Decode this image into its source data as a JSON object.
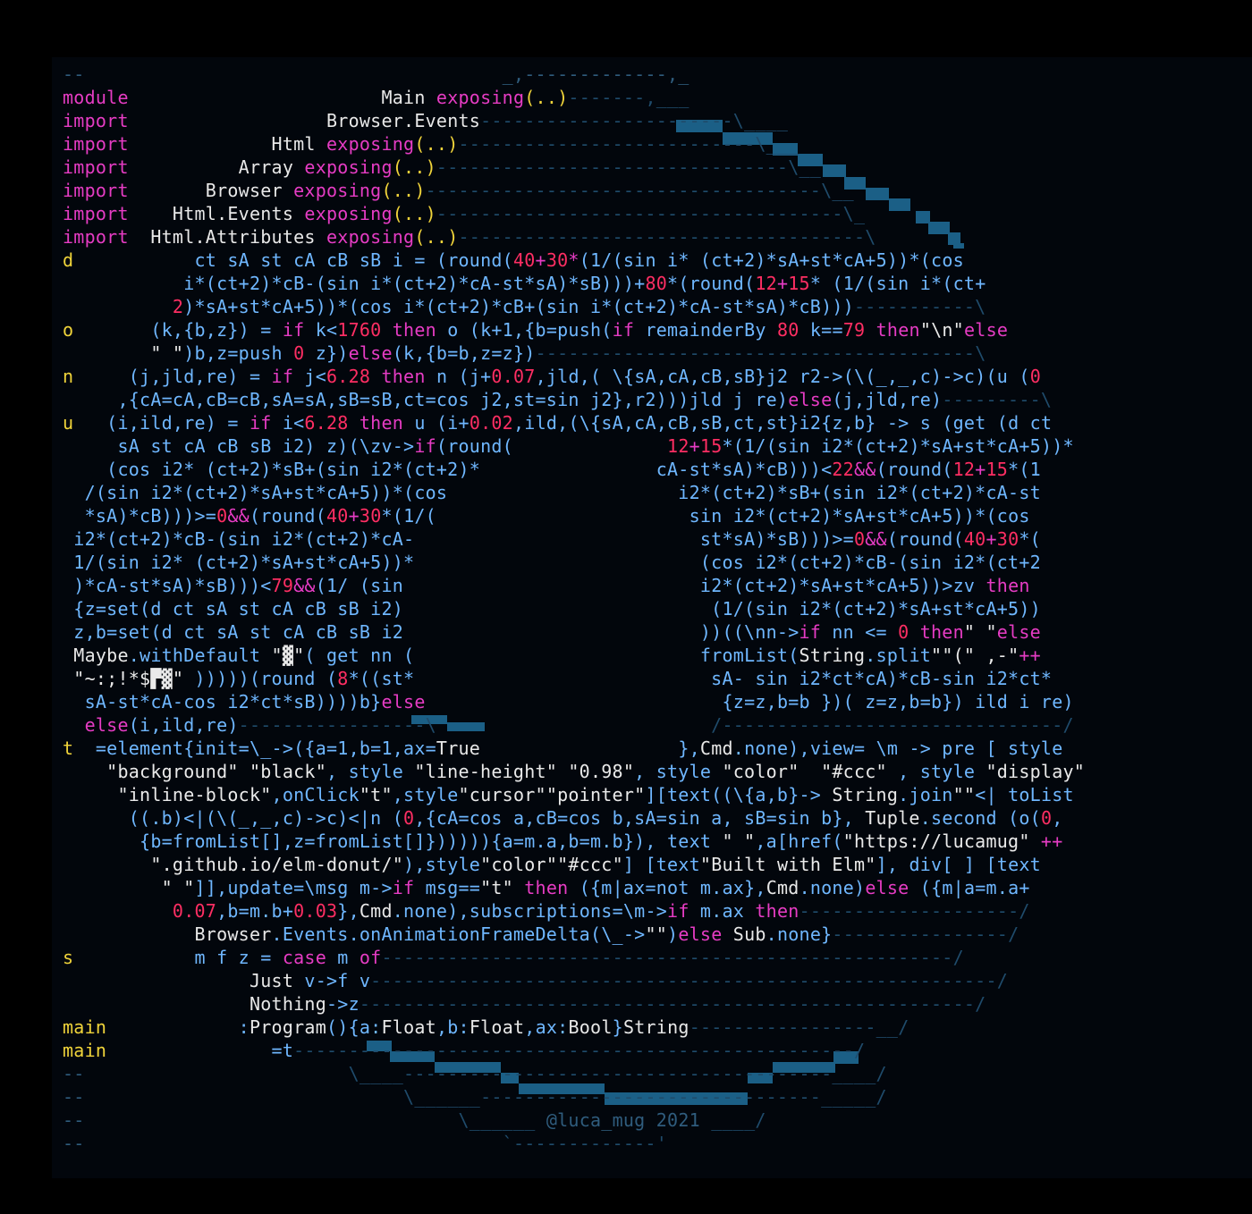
{
  "colors": {
    "background": "#000000",
    "panel": "#02060c",
    "keyword": "#e63cc4",
    "definition": "#f0d43a",
    "module_name": "#e8e8e8",
    "number": "#ff2e63",
    "identifier": "#6fb7ff",
    "comment": "#2f5c7d",
    "donut_shade": "#1b5f86"
  },
  "lines": [
    [
      [
        "cm",
        "--"
      ],
      [
        "cm",
        "                                      _,-------------,_"
      ]
    ],
    [
      [
        "kw",
        "module"
      ],
      [
        "mod",
        "                       Main "
      ],
      [
        "kw",
        "exposing"
      ],
      [
        "def",
        "(..)"
      ],
      [
        "dash",
        "-------,___"
      ]
    ],
    [
      [
        "kw",
        "import"
      ],
      [
        "mod",
        "                  Browser.Events"
      ],
      [
        "dash",
        "-----------------------\\____"
      ]
    ],
    [
      [
        "kw",
        "import"
      ],
      [
        "mod",
        "             Html "
      ],
      [
        "kw",
        "exposing"
      ],
      [
        "def",
        "(..)"
      ],
      [
        "dash",
        "---------------------------\\___"
      ]
    ],
    [
      [
        "kw",
        "import"
      ],
      [
        "mod",
        "          Array "
      ],
      [
        "kw",
        "exposing"
      ],
      [
        "def",
        "(..)"
      ],
      [
        "dash",
        "--------------------------------\\__"
      ]
    ],
    [
      [
        "kw",
        "import"
      ],
      [
        "mod",
        "       Browser "
      ],
      [
        "kw",
        "exposing"
      ],
      [
        "def",
        "(..)"
      ],
      [
        "dash",
        "------------------------------------\\__"
      ]
    ],
    [
      [
        "kw",
        "import"
      ],
      [
        "mod",
        "    Html.Events "
      ],
      [
        "kw",
        "exposing"
      ],
      [
        "def",
        "(..)"
      ],
      [
        "dash",
        "-------------------------------------\\_"
      ]
    ],
    [
      [
        "kw",
        "import"
      ],
      [
        "mod",
        "  Html.Attributes "
      ],
      [
        "kw",
        "exposing"
      ],
      [
        "def",
        "(..)"
      ],
      [
        "dash",
        "-------------------------------------\\"
      ]
    ],
    [
      [
        "def",
        "d"
      ],
      [
        "id",
        "           ct sA st cA cB sB i = (round("
      ],
      [
        "num",
        "40"
      ],
      [
        "op",
        "+"
      ],
      [
        "num",
        "30"
      ],
      [
        "op",
        "*"
      ],
      [
        "id",
        "(1/(sin i* (ct+2)*sA+st*cA+5))*(cos"
      ]
    ],
    [
      [
        "id",
        "           i*(ct+2)*cB-(sin i*(ct+2)*cA-st*sA)*sB)))+"
      ],
      [
        "num",
        "80"
      ],
      [
        "id",
        "*(round("
      ],
      [
        "num",
        "12"
      ],
      [
        "op",
        "+"
      ],
      [
        "num",
        "15"
      ],
      [
        "id",
        "* (1/(sin i*(ct+"
      ]
    ],
    [
      [
        "num",
        "          2"
      ],
      [
        "id",
        ")*sA+st*cA+5))*(cos i*(ct+2)*cB+(sin i*(ct+2)*cA-st*sA)*cB)))"
      ],
      [
        "dash",
        "-----------\\"
      ]
    ],
    [
      [
        "def",
        "o"
      ],
      [
        "id",
        "       (k,{b,z}) = "
      ],
      [
        "kw",
        "if"
      ],
      [
        "id",
        " k<"
      ],
      [
        "num",
        "1760"
      ],
      [
        "kw",
        " then"
      ],
      [
        "id",
        " o (k+1,{b=push("
      ],
      [
        "kw",
        "if"
      ],
      [
        "id",
        " remainderBy "
      ],
      [
        "num",
        "80"
      ],
      [
        "id",
        " k=="
      ],
      [
        "num",
        "79"
      ],
      [
        "kw",
        " then"
      ],
      [
        "str",
        "\"\\n\""
      ],
      [
        "kw",
        "else"
      ]
    ],
    [
      [
        "str",
        "        \" \""
      ],
      [
        "id",
        ")b,z=push "
      ],
      [
        "num",
        "0"
      ],
      [
        "id",
        " z})"
      ],
      [
        "kw",
        "else"
      ],
      [
        "id",
        "(k,{b=b,z=z})"
      ],
      [
        "dash",
        "----------------------------------------\\"
      ]
    ],
    [
      [
        "def",
        "n"
      ],
      [
        "id",
        "     (j,jld,re) = "
      ],
      [
        "kw",
        "if"
      ],
      [
        "id",
        " j<"
      ],
      [
        "num",
        "6.28"
      ],
      [
        "kw",
        " then"
      ],
      [
        "id",
        " n (j+"
      ],
      [
        "num",
        "0.07"
      ],
      [
        "id",
        ",jld,( \\{sA,cA,cB,sB}j2 r2->(\\(_,_,c)->c)(u ("
      ],
      [
        "num",
        "0"
      ]
    ],
    [
      [
        "id",
        "     ,{cA=cA,cB=cB,sA=sA,sB=sB,ct=cos j2,st=sin j2},r2)))jld j re)"
      ],
      [
        "kw",
        "else"
      ],
      [
        "id",
        "(j,jld,re)"
      ],
      [
        "dash",
        "---------\\"
      ]
    ],
    [
      [
        "def",
        "u"
      ],
      [
        "id",
        "   (i,ild,re) = "
      ],
      [
        "kw",
        "if"
      ],
      [
        "id",
        " i<"
      ],
      [
        "num",
        "6.28"
      ],
      [
        "kw",
        " then"
      ],
      [
        "id",
        " u (i+"
      ],
      [
        "num",
        "0.02"
      ],
      [
        "id",
        ",ild,(\\{sA,cA,cB,sB,ct,st}i2{z,b} -> s (get (d ct"
      ]
    ],
    [
      [
        "id",
        "     sA st cA cB sB i2) z)(\\zv->"
      ],
      [
        "kw",
        "if"
      ],
      [
        "id",
        "(round(              "
      ],
      [
        "num",
        "12"
      ],
      [
        "op",
        "+"
      ],
      [
        "num",
        "15"
      ],
      [
        "id",
        "*(1/(sin i2*(ct+2)*sA+st*cA+5))*"
      ]
    ],
    [
      [
        "id",
        "    (cos i2* (ct+2)*sB+(sin i2*(ct+2)*                cA-st*sA)*cB)))<"
      ],
      [
        "num",
        "22"
      ],
      [
        "op",
        "&&"
      ],
      [
        "id",
        "(round("
      ],
      [
        "num",
        "12"
      ],
      [
        "op",
        "+"
      ],
      [
        "num",
        "15"
      ],
      [
        "id",
        "*(1"
      ]
    ],
    [
      [
        "id",
        "  /(sin i2*(ct+2)*sA+st*cA+5))*(cos                     i2*(ct+2)*sB+(sin i2*(ct+2)*cA-st"
      ]
    ],
    [
      [
        "id",
        "  *sA)*cB)))>="
      ],
      [
        "num",
        "0"
      ],
      [
        "op",
        "&&"
      ],
      [
        "id",
        "(round("
      ],
      [
        "num",
        "40"
      ],
      [
        "op",
        "+"
      ],
      [
        "num",
        "30"
      ],
      [
        "id",
        "*(1/(                       sin i2*(ct+2)*sA+st*cA+5))*(cos"
      ]
    ],
    [
      [
        "id",
        " i2*(ct+2)*cB-(sin i2*(ct+2)*cA-                          st*sA)*sB)))>="
      ],
      [
        "num",
        "0"
      ],
      [
        "op",
        "&&"
      ],
      [
        "id",
        "(round("
      ],
      [
        "num",
        "40"
      ],
      [
        "op",
        "+"
      ],
      [
        "num",
        "30"
      ],
      [
        "id",
        "*("
      ]
    ],
    [
      [
        "id",
        " 1/(sin i2* (ct+2)*sA+st*cA+5))*                          (cos i2*(ct+2)*cB-(sin i2*(ct+2"
      ]
    ],
    [
      [
        "id",
        " )*cA-st*sA)*sB)))<"
      ],
      [
        "num",
        "79"
      ],
      [
        "op",
        "&&"
      ],
      [
        "id",
        "(1/ (sin                           i2*(ct+2)*sA+st*cA+5))>zv "
      ],
      [
        "kw",
        "then"
      ]
    ],
    [
      [
        "id",
        " {z=set(d ct sA st cA cB sB i2)                            (1/(sin i2*(ct+2)*sA+st*cA+5))"
      ]
    ],
    [
      [
        "id",
        " z,b=set(d ct sA st cA cB sB i2                           ))((\\nn->"
      ],
      [
        "kw",
        "if"
      ],
      [
        "id",
        " nn <= "
      ],
      [
        "num",
        "0"
      ],
      [
        "kw",
        " then"
      ],
      [
        "str",
        "\" \""
      ],
      [
        "kw",
        "else"
      ]
    ],
    [
      [
        "mod",
        " Maybe"
      ],
      [
        "id",
        ".withDefault "
      ],
      [
        "str",
        "\"▓\""
      ],
      [
        "id",
        "( get nn (                          fromList("
      ],
      [
        "mod",
        "String"
      ],
      [
        "id",
        ".split"
      ],
      [
        "str",
        "\"\"(\" ,-\""
      ],
      [
        "op",
        "++"
      ]
    ],
    [
      [
        "str",
        " \"~:;!*$▛▓\""
      ],
      [
        "id",
        " )))))(round ("
      ],
      [
        "num",
        "8"
      ],
      [
        "id",
        "*((st*                           sA- sin i2*ct*cA)*cB-sin i2*ct*"
      ]
    ],
    [
      [
        "id",
        "  sA-st*cA-cos i2*ct*sB))))b}"
      ],
      [
        "kw",
        "else"
      ],
      [
        "id",
        "                           {z=z,b=b })( z=z,b=b}) ild i re)"
      ]
    ],
    [
      [
        "kw",
        "  else"
      ],
      [
        "id",
        "(i,ild,re)"
      ],
      [
        "dash",
        "-----------------\\                         /-------------------------------/"
      ]
    ],
    [
      [
        "def",
        "t"
      ],
      [
        "id",
        "  =element{init=\\_->({a=1,b=1,ax="
      ],
      [
        "mod",
        "True"
      ],
      [
        "id",
        "                  },"
      ],
      [
        "mod",
        "Cmd"
      ],
      [
        "id",
        ".none),view= \\m -> pre [ style"
      ]
    ],
    [
      [
        "str",
        "    \"background\" \"black\""
      ],
      [
        "id",
        ", style "
      ],
      [
        "str",
        "\"line-height\" \"0.98\""
      ],
      [
        "id",
        ", style "
      ],
      [
        "str",
        "\"color\"  \"#ccc\""
      ],
      [
        "id",
        " , style "
      ],
      [
        "str",
        "\"display\""
      ]
    ],
    [
      [
        "str",
        "     \"inline-block\""
      ],
      [
        "id",
        ",onClick"
      ],
      [
        "str",
        "\"t\""
      ],
      [
        "id",
        ",style"
      ],
      [
        "str",
        "\"cursor\"\"pointer\""
      ],
      [
        "id",
        "][text((\\{a,b}-> "
      ],
      [
        "mod",
        "String"
      ],
      [
        "id",
        ".join"
      ],
      [
        "str",
        "\"\""
      ],
      [
        "id",
        "<| toList"
      ]
    ],
    [
      [
        "id",
        "      ((.b)<|(\\(_,_,c)->c)<|n ("
      ],
      [
        "num",
        "0"
      ],
      [
        "id",
        ",{cA=cos a,cB=cos b,sA=sin a, sB=sin b}, "
      ],
      [
        "mod",
        "Tuple"
      ],
      [
        "id",
        ".second (o("
      ],
      [
        "num",
        "0"
      ],
      [
        "id",
        ","
      ]
    ],
    [
      [
        "id",
        "       {b=fromList[],z=fromList[]}))))){a=m.a,b=m.b}), text "
      ],
      [
        "str",
        "\" \""
      ],
      [
        "id",
        ",a[href("
      ],
      [
        "str",
        "\"https://lucamug\""
      ],
      [
        "op",
        " ++"
      ]
    ],
    [
      [
        "str",
        "        \".github.io/elm-donut/\""
      ],
      [
        "id",
        "),style"
      ],
      [
        "str",
        "\"color\"\"#ccc\""
      ],
      [
        "id",
        "] [text"
      ],
      [
        "str",
        "\"Built with Elm\""
      ],
      [
        "id",
        "], div[ ] [text"
      ]
    ],
    [
      [
        "str",
        "         \" \""
      ],
      [
        "id",
        "]],update=\\msg m->"
      ],
      [
        "kw",
        "if"
      ],
      [
        "id",
        " msg=="
      ],
      [
        "str",
        "\"t\""
      ],
      [
        "kw",
        " then"
      ],
      [
        "id",
        " ({m|ax=not m.ax},"
      ],
      [
        "mod",
        "Cmd"
      ],
      [
        "id",
        ".none)"
      ],
      [
        "kw",
        "else"
      ],
      [
        "id",
        " ({m|a=m.a+"
      ]
    ],
    [
      [
        "num",
        "          0.07"
      ],
      [
        "id",
        ",b=m.b+"
      ],
      [
        "num",
        "0.03"
      ],
      [
        "id",
        "},"
      ],
      [
        "mod",
        "Cmd"
      ],
      [
        "id",
        ".none),subscriptions=\\m->"
      ],
      [
        "kw",
        "if"
      ],
      [
        "id",
        " m.ax "
      ],
      [
        "kw",
        "then"
      ],
      [
        "dash",
        "--------------------/"
      ]
    ],
    [
      [
        "mod",
        "            Browser"
      ],
      [
        "id",
        ".Events.onAnimationFrameDelta(\\_->"
      ],
      [
        "str",
        "\"\""
      ],
      [
        "id",
        ")"
      ],
      [
        "kw",
        "else"
      ],
      [
        "mod",
        " Sub"
      ],
      [
        "id",
        ".none}"
      ],
      [
        "dash",
        "----------------/"
      ]
    ],
    [
      [
        "def",
        "s"
      ],
      [
        "id",
        "           m f z = "
      ],
      [
        "kw",
        "case"
      ],
      [
        "id",
        " m "
      ],
      [
        "kw",
        "of"
      ],
      [
        "dash",
        "----------------------------------------------------/"
      ]
    ],
    [
      [
        "mod",
        "                 Just"
      ],
      [
        "id",
        " v->f v"
      ],
      [
        "dash",
        "---------------------------------------------------------/"
      ]
    ],
    [
      [
        "mod",
        "                 Nothing"
      ],
      [
        "id",
        "->z"
      ],
      [
        "dash",
        "--------------------------------------------------------/"
      ]
    ],
    [
      [
        "def",
        "main"
      ],
      [
        "id",
        "            :"
      ],
      [
        "mod",
        "Program"
      ],
      [
        "id",
        "(){a:"
      ],
      [
        "mod",
        "Float"
      ],
      [
        "id",
        ",b:"
      ],
      [
        "mod",
        "Float"
      ],
      [
        "id",
        ",ax:"
      ],
      [
        "mod",
        "Bool"
      ],
      [
        "id",
        "}"
      ],
      [
        "mod",
        "String"
      ],
      [
        "dash",
        "-----------------__/"
      ]
    ],
    [
      [
        "def",
        "main"
      ],
      [
        "id",
        "               =t"
      ],
      [
        "dash",
        "---------------------------------------------------/"
      ]
    ],
    [
      [
        "cm",
        "--"
      ],
      [
        "dash",
        "                        \\____---------------------------------------____/"
      ]
    ],
    [
      [
        "cm",
        "--"
      ],
      [
        "dash",
        "                             \\______-------------------------------_____/"
      ]
    ],
    [
      [
        "cm",
        "--"
      ],
      [
        "dash",
        "                                  \\______"
      ],
      [
        "cm",
        " @luca_mug 2021"
      ],
      [
        "dash",
        " ____/"
      ]
    ],
    [
      [
        "cm",
        "--"
      ],
      [
        "dash",
        "                                      `-------------'"
      ]
    ]
  ]
}
